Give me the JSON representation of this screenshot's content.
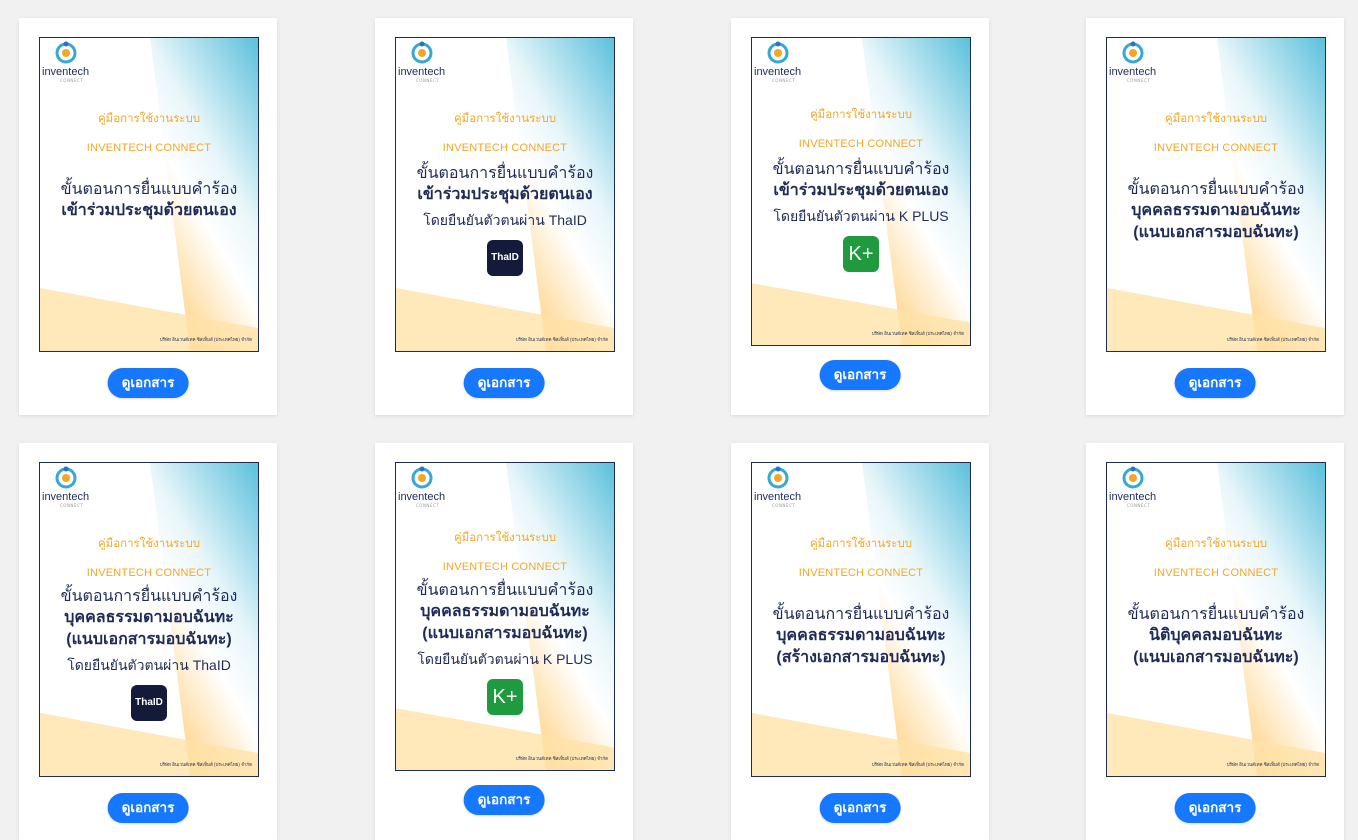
{
  "logo": {
    "word": "inventech",
    "sub": "CONNECT"
  },
  "footer": "บริษัท อินเวนต์เทค ซิสเท็มส์ (ประเทศไทย) จำกัด",
  "view_button_label": "ดูเอกสาร",
  "manual_label": "คู่มือการใช้งานระบบ",
  "brand_label": "INVENTECH CONNECT",
  "apps": {
    "thaid": "ThaID",
    "kplus": "K+"
  },
  "cards": [
    {
      "step": "ขั้นตอนการยื่นแบบคำร้อง",
      "bold1": "เข้าร่วมประชุมด้วยตนเอง",
      "bold2": "",
      "via": "",
      "app": ""
    },
    {
      "step": "ขั้นตอนการยื่นแบบคำร้อง",
      "bold1": "เข้าร่วมประชุมด้วยตนเอง",
      "bold2": "",
      "via": "โดยยืนยันตัวตนผ่าน ThaID",
      "app": "thaid"
    },
    {
      "step": "ขั้นตอนการยื่นแบบคำร้อง",
      "bold1": "เข้าร่วมประชุมด้วยตนเอง",
      "bold2": "",
      "via": "โดยยืนยันตัวตนผ่าน K PLUS",
      "app": "kplus"
    },
    {
      "step": "ขั้นตอนการยื่นแบบคำร้อง",
      "bold1": "บุคคลธรรมดามอบฉันทะ",
      "bold2": "(แนบเอกสารมอบฉันทะ)",
      "via": "",
      "app": ""
    },
    {
      "step": "ขั้นตอนการยื่นแบบคำร้อง",
      "bold1": "บุคคลธรรมดามอบฉันทะ",
      "bold2": "(แนบเอกสารมอบฉันทะ)",
      "via": "โดยยืนยันตัวตนผ่าน ThaID",
      "app": "thaid"
    },
    {
      "step": "ขั้นตอนการยื่นแบบคำร้อง",
      "bold1": "บุคคลธรรมดามอบฉันทะ",
      "bold2": "(แนบเอกสารมอบฉันทะ)",
      "via": "โดยยืนยันตัวตนผ่าน K PLUS",
      "app": "kplus"
    },
    {
      "step": "ขั้นตอนการยื่นแบบคำร้อง",
      "bold1": "บุคคลธรรมดามอบฉันทะ",
      "bold2": "(สร้างเอกสารมอบฉันทะ)",
      "via": "",
      "app": ""
    },
    {
      "step": "ขั้นตอนการยื่นแบบคำร้อง",
      "bold1": "นิติบุคคลมอบฉันทะ",
      "bold2": "(แนบเอกสารมอบฉันทะ)",
      "via": "",
      "app": ""
    }
  ]
}
